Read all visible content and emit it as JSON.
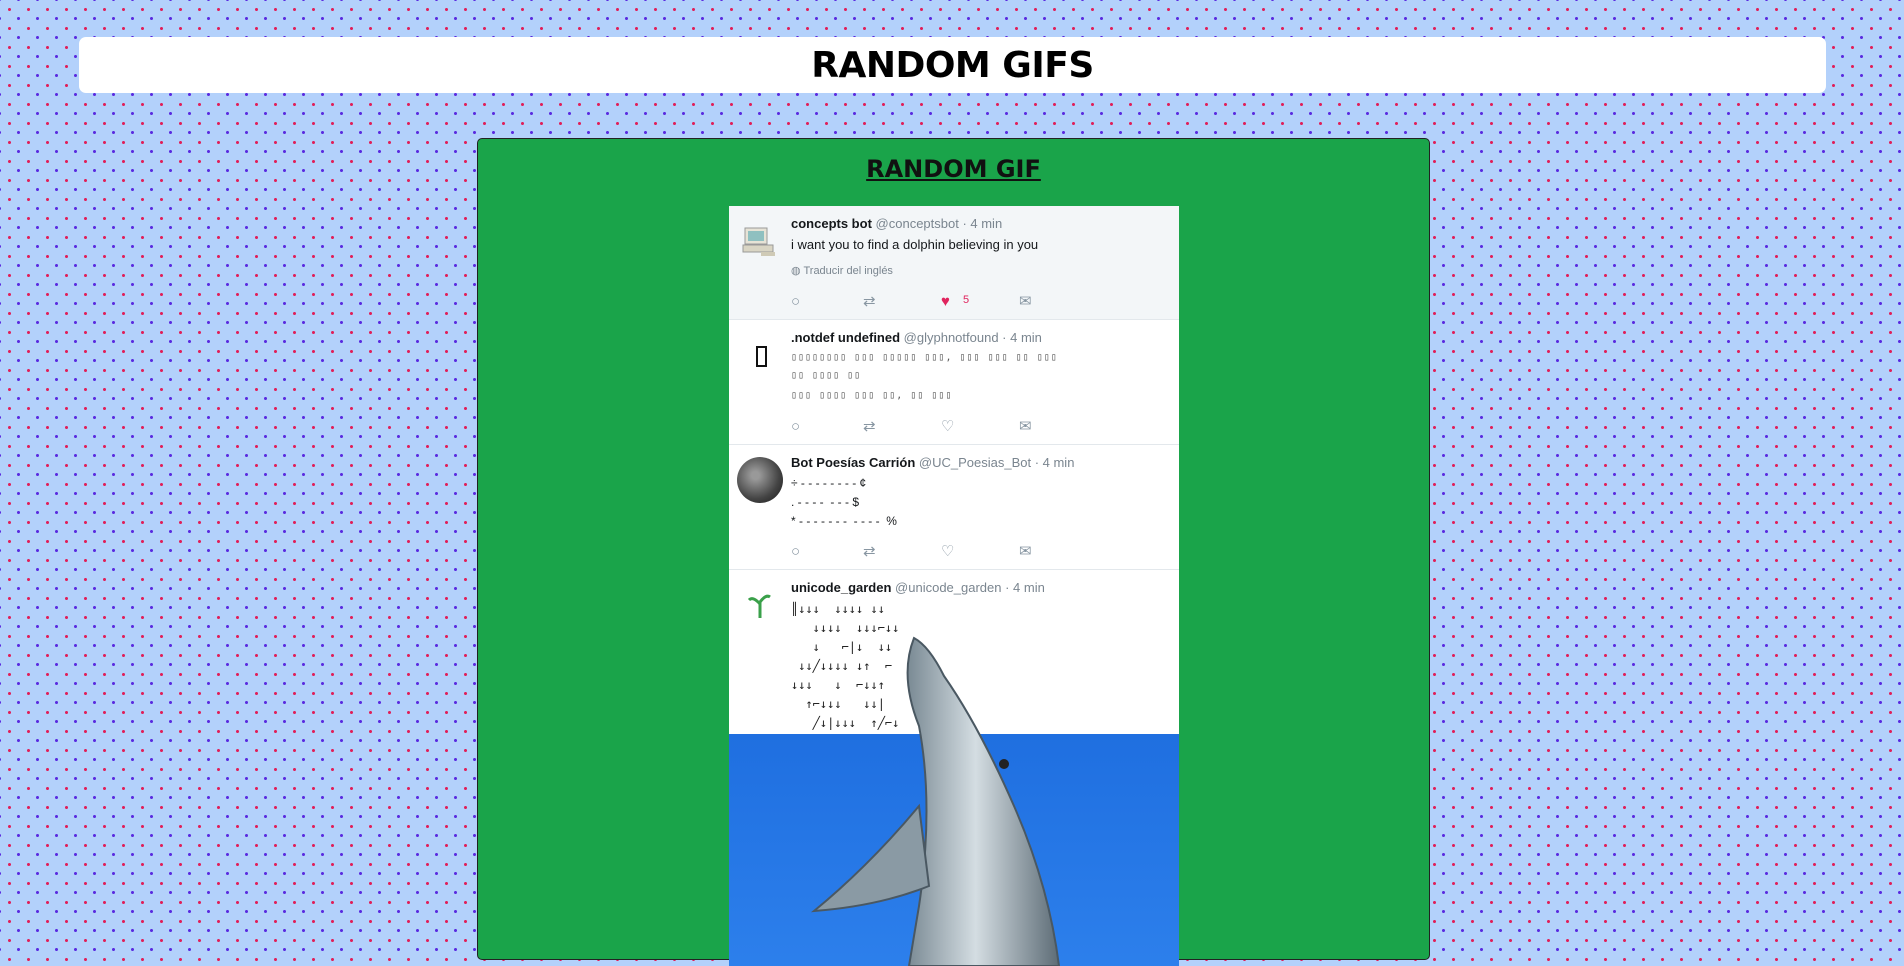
{
  "header": {
    "title": "RANDOM GIFS"
  },
  "panel": {
    "title": "RANDOM GIF"
  },
  "gif": {
    "tweets": [
      {
        "name": "concepts bot",
        "meta": "@conceptsbot · 4 min",
        "lines": [
          "i want you to find a dolphin believing in you"
        ],
        "translate": "Traducir del inglés",
        "like_count": "5"
      },
      {
        "name": ".notdef undefined",
        "meta": "@glyphnotfound · 4 min",
        "lines": [
          "▯▯▯▯▯▯▯▯ ▯▯▯ ▯▯▯▯▯ ▯▯▯, ▯▯▯ ▯▯▯ ▯▯ ▯▯▯",
          "▯▯ ▯▯▯▯ ▯▯",
          "▯▯▯ ▯▯▯▯ ▯▯▯ ▯▯, ▯▯ ▯▯▯"
        ]
      },
      {
        "name": "Bot Poesías Carrión",
        "meta": "@UC_Poesias_Bot · 4 min",
        "lines": [
          "÷ - - - - - - - - ¢",
          ". - - - -  - - - $",
          "* - - - - - - -  - - - -  %"
        ]
      },
      {
        "name": "unicode_garden",
        "meta": "@unicode_garden · 4 min",
        "art": "║↓↓↓  ↓↓↓↓ ↓↓\n   ↓↓↓↓  ↓↓↓⌐↓↓\n   ↓   ⌐|↓  ↓↓\n ↓↓╱↓↓↓↓ ↓↑  ⌐\n↓↓↓   ↓  ⌐↓↓↑\n  ↑⌐↓↓↓   ↓↓|\n   ╱↓|↓↓↓  ↑╱⌐↓"
      }
    ]
  },
  "colors": {
    "background": "#b3d1fb",
    "panel": "#1aa44a",
    "like": "#e0245e",
    "sea": "#1f6fe0"
  }
}
